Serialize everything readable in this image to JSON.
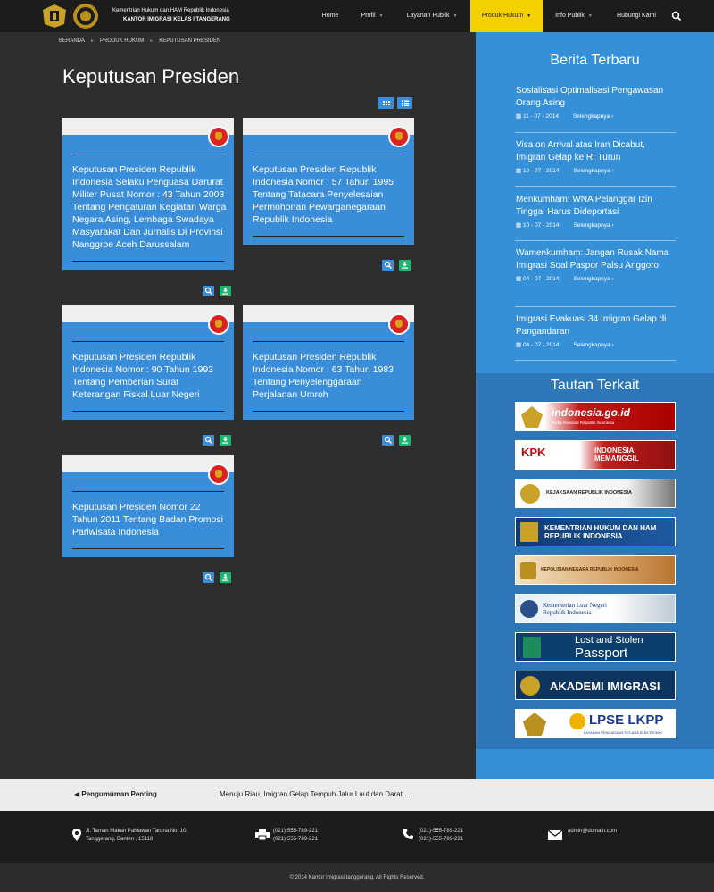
{
  "header": {
    "brand_line1": "Kementrian Hukum dan HAM Republik Indonesia",
    "brand_line2": "KANTOR IMIGRASI KELAS I TANGERANG"
  },
  "nav": {
    "items": [
      {
        "label": "Home"
      },
      {
        "label": "Profil"
      },
      {
        "label": "Layanan Publik"
      },
      {
        "label": "Produk Hukum"
      },
      {
        "label": "Info Publik"
      },
      {
        "label": "Hubungi Kami"
      }
    ]
  },
  "breadcrumb": [
    "BERANDA",
    "PRODUK HUKUM",
    "KEPUTUSAN PRESIDEN"
  ],
  "page": {
    "title": "Keputusan Presiden"
  },
  "documents": [
    {
      "title": "Keputusan Presiden Republik Indonesia Selaku Penguasa Darurat Militer Pusat Nomor : 43 Tahun 2003 Tentang Pengaturan Kegiatan Warga Negara Asing, Lembaga Swadaya Masyarakat Dan Jurnalis Di Provinsi Nanggroe Aceh Darussalam"
    },
    {
      "title": "Keputusan Presiden Republik Indonesia Nomor : 57 Tahun 1995 Tentang Tatacara Penyelesaian Permohonan Pewarganegaraan Republik Indonesia"
    },
    {
      "title": "Keputusan Presiden Republik Indonesia Nomor : 90 Tahun 1993 Tentang Pemberian Surat Keterangan Fiskal Luar Negeri"
    },
    {
      "title": "Keputusan Presiden Republik Indonesia Nomor : 63 Tahun 1983 Tentang Penyelenggaraan Perjalanan Umroh"
    },
    {
      "title": "Keputusan Presiden Nomor 22 Tahun 2011 Tentang Badan Promosi Pariwisata Indonesia"
    }
  ],
  "sidebar": {
    "news_title": "Berita Terbaru",
    "news": [
      {
        "title": "Sosialisasi Optimalisasi Pengawasan Orang Asing",
        "date": "11 - 07 - 2014",
        "more": "Selengkapnya ›"
      },
      {
        "title": "Visa on Arrival atas Iran Dicabut, Imigran Gelap ke RI Turun",
        "date": "10 - 07 - 2014",
        "more": "Selengkapnya ›"
      },
      {
        "title": "Menkumham: WNA Pelanggar Izin Tinggal Harus Dideportasi",
        "date": "10 - 07 - 2014",
        "more": "Selengkapnya ›"
      },
      {
        "title": "Wamenkumham: Jangan Rusak Nama Imigrasi Soal Paspor Palsu Anggoro",
        "date": "04 - 07 - 2014",
        "more": "Selengkapnya ›"
      },
      {
        "title": "Imigrasi Evakuasi 34 Imigran Gelap di Pangandaran",
        "date": "04 - 07 - 2014",
        "more": "Selengkapnya ›"
      }
    ],
    "links_title": "Tautan Terkait",
    "links": [
      {
        "label": "indonesia.go.id",
        "sub": "Portal Nasional Republik Indonesia"
      },
      {
        "label": "KPK",
        "sub": "INDONESIA MEMANGGIL"
      },
      {
        "label": "KEJAKSAAN REPUBLIK INDONESIA"
      },
      {
        "label": "KEMENTRIAN HUKUM DAN HAM REPUBLIK INDONESIA"
      },
      {
        "label": "KEPOLISIAN NEGARA REPUBLIK INDONESIA"
      },
      {
        "label": "Kementerian Luar Negeri Republik Indonesia"
      },
      {
        "label": "Lost and Stolen",
        "sub": "Passport"
      },
      {
        "label": "AKADEMI IMIGRASI"
      },
      {
        "label": "LPSE LKPP",
        "sub": "LAYANAN PENGADAAN SECARA ELEKTRONIK"
      }
    ]
  },
  "announcement": {
    "label": "Pengumuman Penting",
    "text": "Menuju Riau, Imigran Gelap Tempuh Jalur Laut dan Darat ..."
  },
  "footer": {
    "address_line1": "Jl. Taman Makan Pahlawan Taruna No. 10.",
    "address_line2": "Tanggerang, Banten , 15118",
    "fax1": "(021)-555-789-221",
    "fax2": "(021)-555-789-221",
    "phone1": "(021)-555-789-221",
    "phone2": "(021)-555-789-221",
    "email": "admin@domain.com",
    "copyright": "© 2014 Kantor Imigrasi tanggerang. All Rights Reserved."
  },
  "colors": {
    "accent": "#3a8dd8",
    "nav_active": "#f5d000",
    "download": "#1fb571",
    "sidebar": "#3590d8",
    "sidebar_dark": "#2d77b9"
  },
  "icons": {
    "search": "search-icon",
    "view_grid": "grid-icon",
    "view_list": "list-icon",
    "card_search": "search-icon",
    "card_download": "download-icon",
    "calendar": "calendar-icon",
    "megaphone": "megaphone-icon",
    "map_marker": "map-marker-icon",
    "fax": "fax-icon",
    "phone": "phone-icon",
    "envelope": "envelope-icon"
  }
}
